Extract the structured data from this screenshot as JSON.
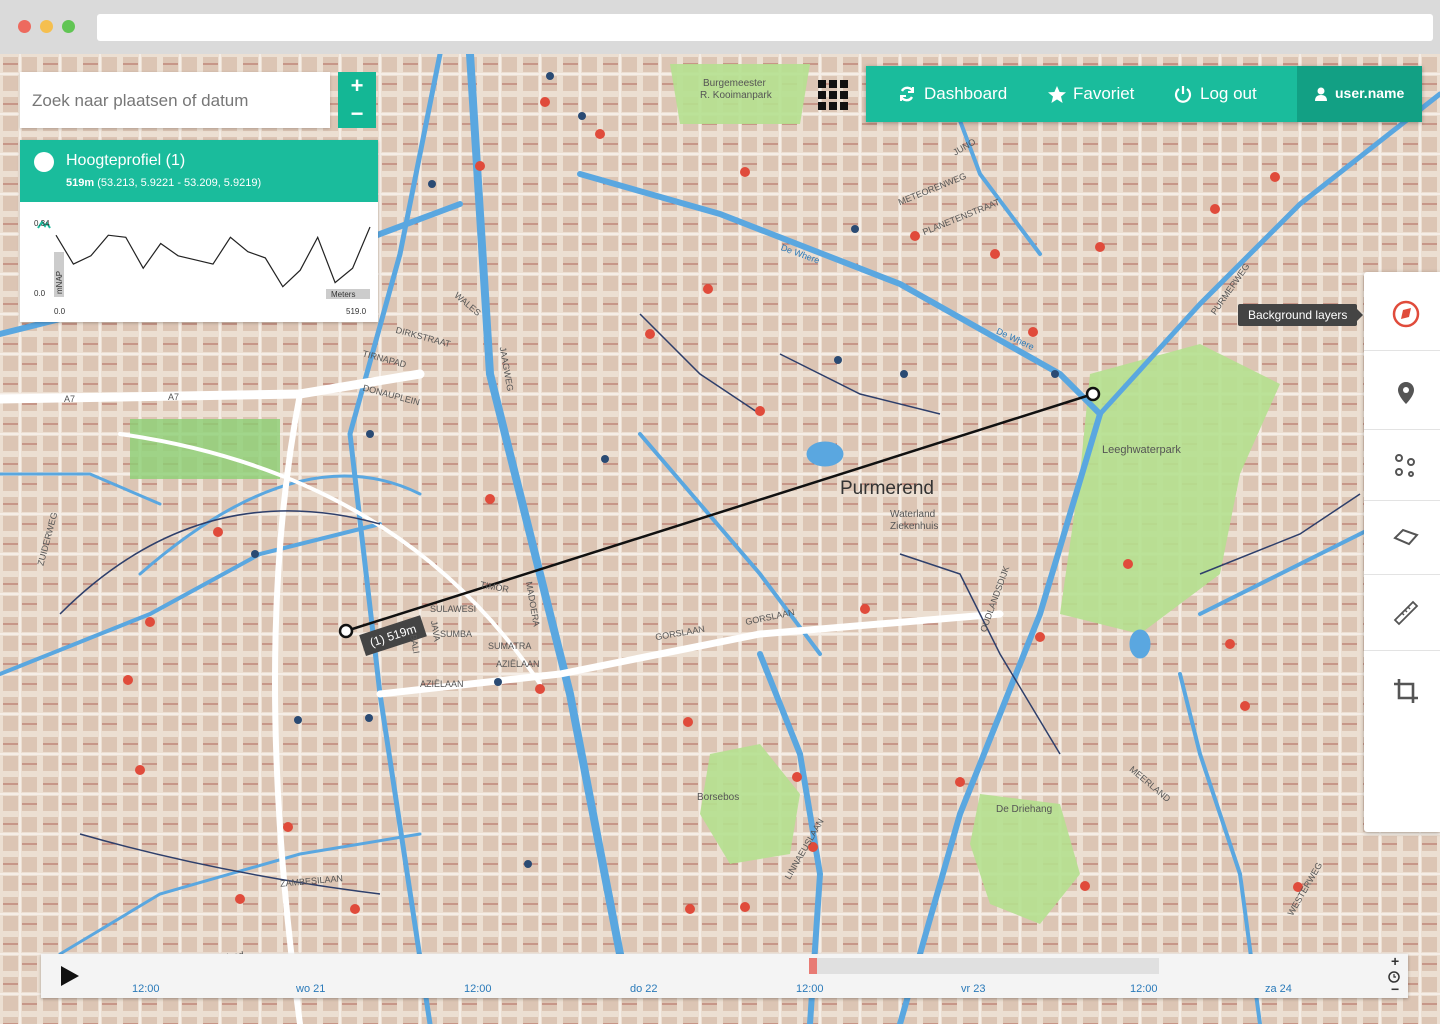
{
  "browser": {
    "dots": [
      "#ed6a5e",
      "#f5bf4f",
      "#61c554"
    ]
  },
  "search": {
    "placeholder": "Zoek naar plaatsen of datum"
  },
  "zoom": {
    "in": "+",
    "out": "−"
  },
  "profile": {
    "title": "Hoogteprofiel (1)",
    "distance": "519m",
    "coords": "(53.213, 5.9221 - 53.209, 5.9219)",
    "y_axis_label": "mNAP",
    "y_max": "0.34",
    "y_min": "0.0",
    "x_min": "0.0",
    "x_max": "519.0",
    "x_unit": "Meters",
    "values": [
      0.3,
      0.16,
      0.2,
      0.3,
      0.29,
      0.14,
      0.26,
      0.2,
      0.18,
      0.16,
      0.29,
      0.22,
      0.19,
      0.05,
      0.13,
      0.29,
      0.07,
      0.14,
      0.34
    ]
  },
  "nav": {
    "dashboard": "Dashboard",
    "favoriet": "Favoriet",
    "logout": "Log out",
    "user": "user.name",
    "accent": "#1abc9c"
  },
  "toolbar": {
    "tooltip": "Background layers",
    "tools": [
      "background-layers-icon",
      "map-marker-icon",
      "point-cluster-icon",
      "polygon-icon",
      "ruler-icon",
      "crop-icon"
    ]
  },
  "map": {
    "city": "Purmerend",
    "measurement": "(1) 519m",
    "labels": {
      "burgemeester": "Burgemeester",
      "koolmanpark": "R. Kooimanpark",
      "juno": "JUNO",
      "meteorenweg": "METEORENWEG",
      "planetenstraat": "PLANETENSTRAAT",
      "wales": "WALES",
      "a7": "A7",
      "a7b": "A7",
      "zuiderweg": "ZUIDERWEG",
      "jaagweg": "JAAGWEG",
      "leeghwaterpark": "Leeghwaterpark",
      "waterland": "Waterland",
      "ziekenhuis": "Ziekenhuis",
      "gorslaan": "GORSLAAN",
      "gorslaan2": "GORSLAAN",
      "azielaan": "AZIËLAAN",
      "azielaan2": "AZIËLAAN",
      "sulawesi": "SULAWESI",
      "sumba": "SUMBA",
      "sumatra": "SUMATRA",
      "borsebos": "Borsebos",
      "de_driehang": "De Driehang",
      "linnaeuslaan": "LINNAEUSLAAN",
      "meerland": "MEERLAND",
      "westerweg": "WESTERWEG",
      "zambesilaan": "ZAMBESILAAN",
      "de_where": "De Where",
      "de_where2": "De Where",
      "purmerweg": "PURMERWEG",
      "dirkstraat": "DIRKSTRAAT",
      "tirnapad": "TIRNAPAD",
      "donauplein": "DONAUPLEIN",
      "bali": "BALI",
      "java": "JAVA",
      "madoera": "MADOERA",
      "timor": "TIMOR",
      "oudlandsdijk": "OUDLANDSDIJK",
      "heideland": "heidelandpad"
    }
  },
  "timeline": {
    "ticks": [
      "12:00",
      "wo 21",
      "12:00",
      "do 22",
      "12:00",
      "vr 23",
      "12:00",
      "za 24"
    ],
    "zoom_in": "+",
    "zoom_out": "−"
  }
}
